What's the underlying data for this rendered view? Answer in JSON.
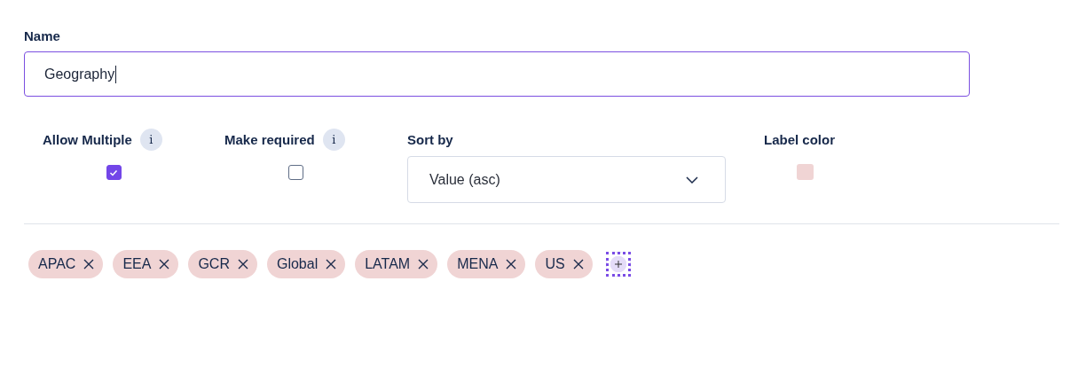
{
  "name_field": {
    "label": "Name",
    "value": "Geography",
    "focused": true
  },
  "options": [
    {
      "kind": "checkbox",
      "label": "Allow Multiple",
      "info": "i",
      "checked": true
    },
    {
      "kind": "checkbox",
      "label": "Make required",
      "info": "i",
      "checked": false
    },
    {
      "kind": "select",
      "label": "Sort by",
      "value": "Value (asc)"
    },
    {
      "kind": "color",
      "label": "Label color",
      "color": "#f0d4d4"
    }
  ],
  "tags": [
    {
      "label": "APAC",
      "color": "#f0d4d4"
    },
    {
      "label": "EEA",
      "color": "#f0d4d4"
    },
    {
      "label": "GCR",
      "color": "#f0d4d4"
    },
    {
      "label": "Global",
      "color": "#f0d4d4"
    },
    {
      "label": "LATAM",
      "color": "#f0d4d4"
    },
    {
      "label": "MENA",
      "color": "#f0d4d4"
    },
    {
      "label": "US",
      "color": "#f0d4d4"
    }
  ]
}
